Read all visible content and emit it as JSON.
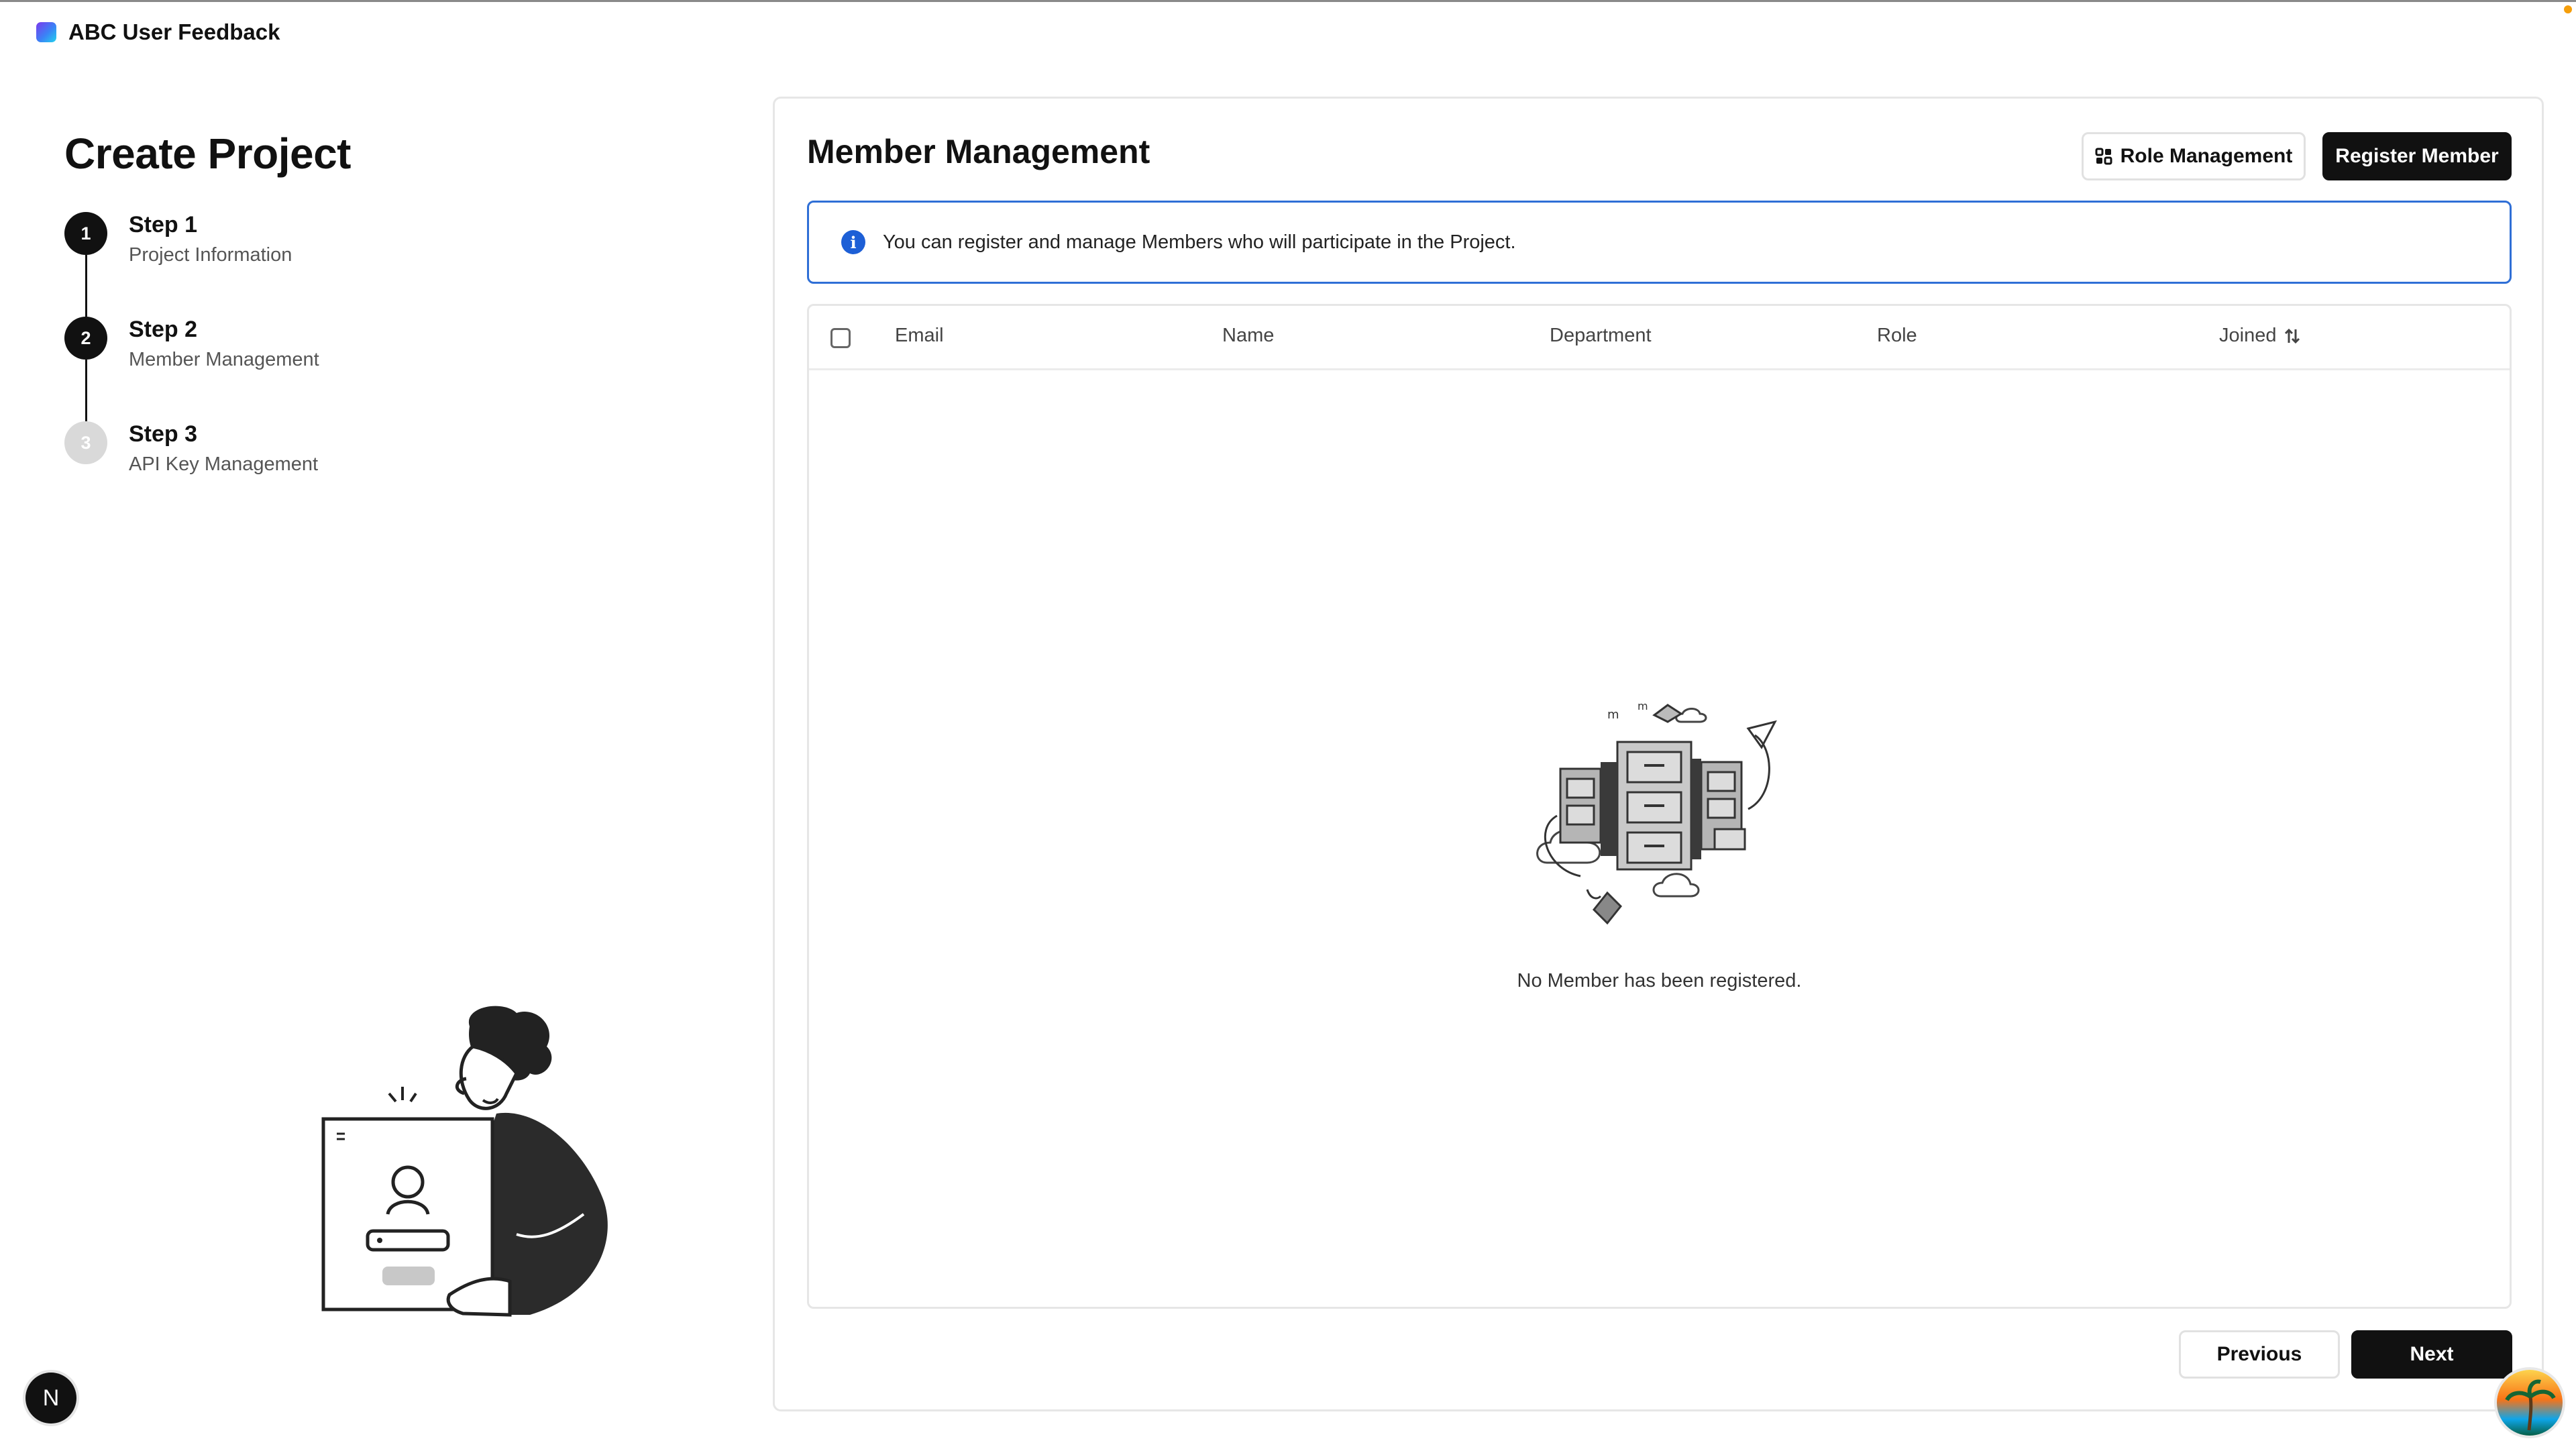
{
  "app": {
    "title": "ABC User Feedback"
  },
  "page": {
    "title": "Create Project"
  },
  "steps": [
    {
      "number": "1",
      "title": "Step 1",
      "subtitle": "Project Information",
      "state": "complete"
    },
    {
      "number": "2",
      "title": "Step 2",
      "subtitle": "Member Management",
      "state": "active"
    },
    {
      "number": "3",
      "title": "Step 3",
      "subtitle": "API Key Management",
      "state": "inactive"
    }
  ],
  "main": {
    "title": "Member Management",
    "role_management_label": "Role Management",
    "register_member_label": "Register Member",
    "info_text": "You can register and manage Members who will participate in the Project.",
    "table": {
      "columns": [
        "Email",
        "Name",
        "Department",
        "Role",
        "Joined"
      ],
      "rows": [],
      "empty_text": "No Member has been registered."
    },
    "previous_label": "Previous",
    "next_label": "Next"
  },
  "badge": {
    "letter": "N"
  },
  "colors": {
    "primary": "#111111",
    "info": "#1d5fd6",
    "border": "#e6e6e6"
  },
  "icons": [
    "logo-icon",
    "role-management-icon",
    "info-icon",
    "sort-icon",
    "next-badge-icon",
    "avatar"
  ]
}
